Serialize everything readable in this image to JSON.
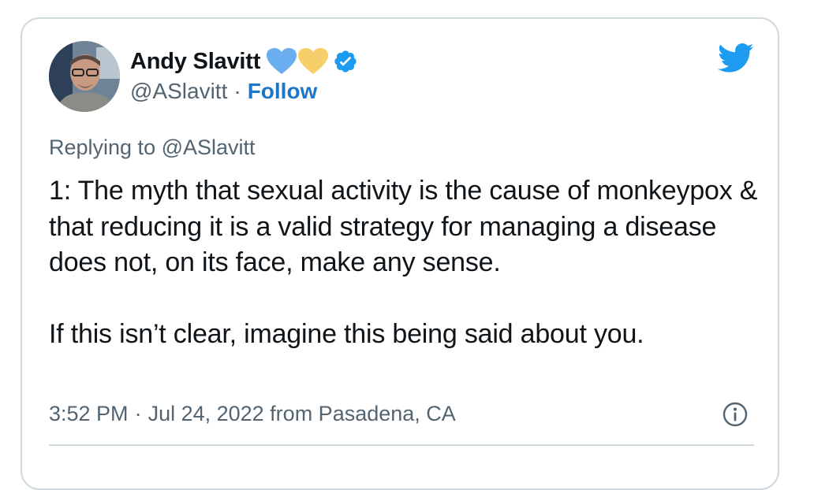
{
  "author": {
    "name": "Andy Slavitt",
    "handle": "@ASlavitt",
    "separator": "·",
    "follow_label": "Follow",
    "badges": [
      "blue-heart-icon",
      "yellow-heart-icon",
      "verified-badge-icon"
    ]
  },
  "reply": {
    "text": "Replying to @ASlavitt"
  },
  "tweet": {
    "text": "1: The myth that sexual activity is the cause of monkeypox & that reducing it is a valid strategy for managing a disease does not, on its face, make any sense.\n\nIf this isn’t clear, imagine this being said about you."
  },
  "meta": {
    "time": "3:52 PM",
    "separator": "·",
    "date_location": "Jul 24, 2022 from Pasadena, CA"
  },
  "colors": {
    "twitter_blue": "#1d9bf0",
    "follow_blue": "#1d77c9",
    "secondary_text": "#536471",
    "primary_text": "#0f1419",
    "border": "#cfd9de",
    "blue_heart": "#6aaef0",
    "yellow_heart": "#f7cf6a"
  }
}
